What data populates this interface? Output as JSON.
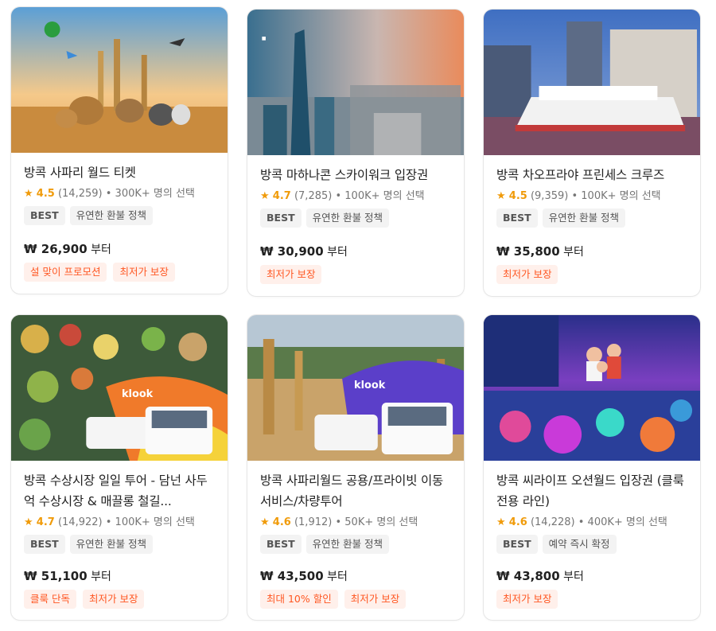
{
  "colors": {
    "accent": "#ff5722",
    "promo_bg": "#fff0eb",
    "star": "#f09b0a"
  },
  "cards": [
    {
      "title": "방콕 사파리 월드 티켓",
      "star": "★",
      "score": "4.5",
      "reviews": "(14,259)",
      "bookings": "• 300K+ 명의 선택",
      "tags": [
        "BEST",
        "유연한 환불 정책"
      ],
      "price": "₩ 26,900",
      "price_suffix": "부터",
      "promos": [
        "설 맞이 프로모션",
        "최저가 보장"
      ],
      "image": "safari-animals-image"
    },
    {
      "title": "방콕 마하나콘 스카이워크 입장권",
      "star": "★",
      "score": "4.7",
      "reviews": "(7,285)",
      "bookings": "• 100K+ 명의 선택",
      "tags": [
        "BEST",
        "유연한 환불 정책"
      ],
      "price": "₩ 30,900",
      "price_suffix": "부터",
      "promos": [
        "최저가 보장"
      ],
      "image": "mahanakhon-tower-image"
    },
    {
      "title": "방콕 차오프라야 프린세스 크루즈",
      "star": "★",
      "score": "4.5",
      "reviews": "(9,359)",
      "bookings": "• 100K+ 명의 선택",
      "tags": [
        "BEST",
        "유연한 환불 정책"
      ],
      "price": "₩ 35,800",
      "price_suffix": "부터",
      "promos": [
        "최저가 보장"
      ],
      "image": "river-cruise-image"
    },
    {
      "title": "방콕 수상시장 일일 투어 - 담넌 사두억 수상시장 & 매끌롱 철길...",
      "star": "★",
      "score": "4.7",
      "reviews": "(14,922)",
      "bookings": "• 100K+ 명의 선택",
      "tags": [
        "BEST",
        "유연한 환불 정책"
      ],
      "price": "₩ 51,100",
      "price_suffix": "부터",
      "promos": [
        "클룩 단독",
        "최저가 보장"
      ],
      "image": "floating-market-image",
      "overlay": "klook"
    },
    {
      "title": "방콕 사파리월드 공용/프라이빗 이동 서비스/차량투어",
      "star": "★",
      "score": "4.6",
      "reviews": "(1,912)",
      "bookings": "• 50K+ 명의 선택",
      "tags": [
        "BEST",
        "유연한 환불 정책"
      ],
      "price": "₩ 43,500",
      "price_suffix": "부터",
      "promos": [
        "최대 10% 할인",
        "최저가 보장"
      ],
      "image": "safari-transfer-image",
      "overlay": "klook"
    },
    {
      "title": "방콕 씨라이프 오션월드 입장권 (클룩 전용 라인)",
      "star": "★",
      "score": "4.6",
      "reviews": "(14,228)",
      "bookings": "• 400K+ 명의 선택",
      "tags": [
        "BEST",
        "예약 즉시 확정"
      ],
      "price": "₩ 43,800",
      "price_suffix": "부터",
      "promos": [
        "최저가 보장"
      ],
      "image": "sea-life-aquarium-image"
    }
  ]
}
